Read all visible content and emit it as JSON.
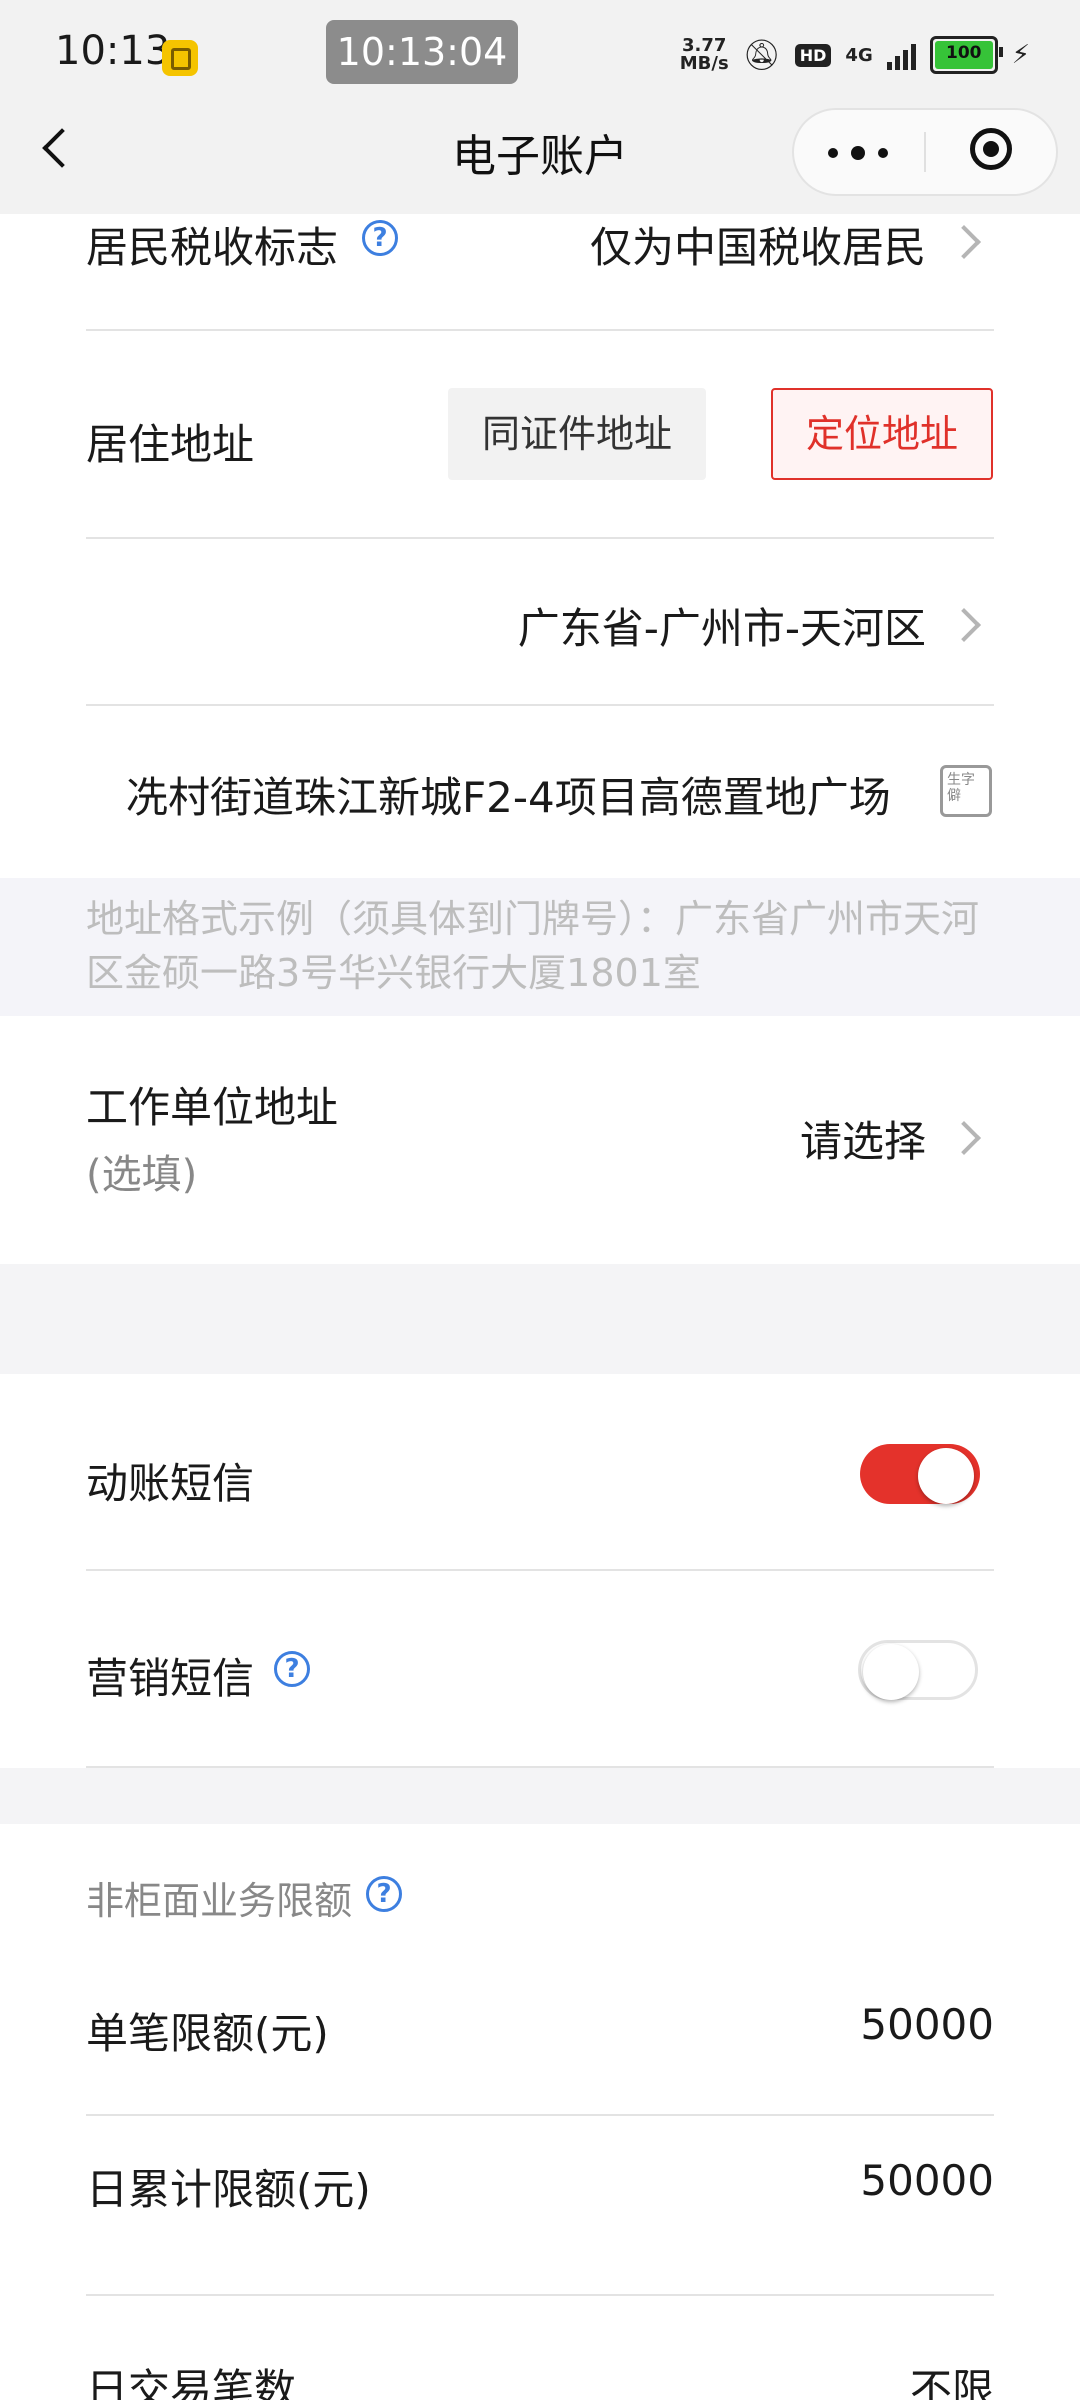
{
  "status_bar": {
    "time": "10:13",
    "clock": "10:13:04",
    "speed_value": "3.77",
    "speed_unit": "MB/s",
    "hd": "HD",
    "network": "4G",
    "battery": "100"
  },
  "nav": {
    "title": "电子账户",
    "back_icon": "chevron-left-icon",
    "more_icon": "more-dots-icon",
    "close_icon": "target-icon"
  },
  "form": {
    "tax_label": "居民税收标志",
    "tax_value": "仅为中国税收居民",
    "residence_label": "居住地址",
    "same_as_id_button": "同证件地址",
    "locate_button": "定位地址",
    "region_value": "广东省-广州市-天河区",
    "street_value": "冼村街道珠江新城F2-4项目高德置地广场",
    "address_hint": "地址格式示例（须具体到门牌号）：广东省广州市天河区金硕一路3号华兴银行大厦1801室",
    "work_label": "工作单位地址",
    "work_optional": "(选填)",
    "work_value": "请选择"
  },
  "sms": {
    "transaction_label": "动账短信",
    "transaction_on": true,
    "marketing_label": "营销短信",
    "marketing_on": false
  },
  "limits": {
    "section_title": "非柜面业务限额",
    "single_label": "单笔限额(元)",
    "single_value": "50000",
    "daily_label": "日累计限额(元)",
    "daily_value": "50000",
    "count_label": "日交易笔数",
    "count_value": "不限"
  },
  "colors": {
    "accent_red": "#e4322b",
    "help_blue": "#3d7fe0"
  }
}
